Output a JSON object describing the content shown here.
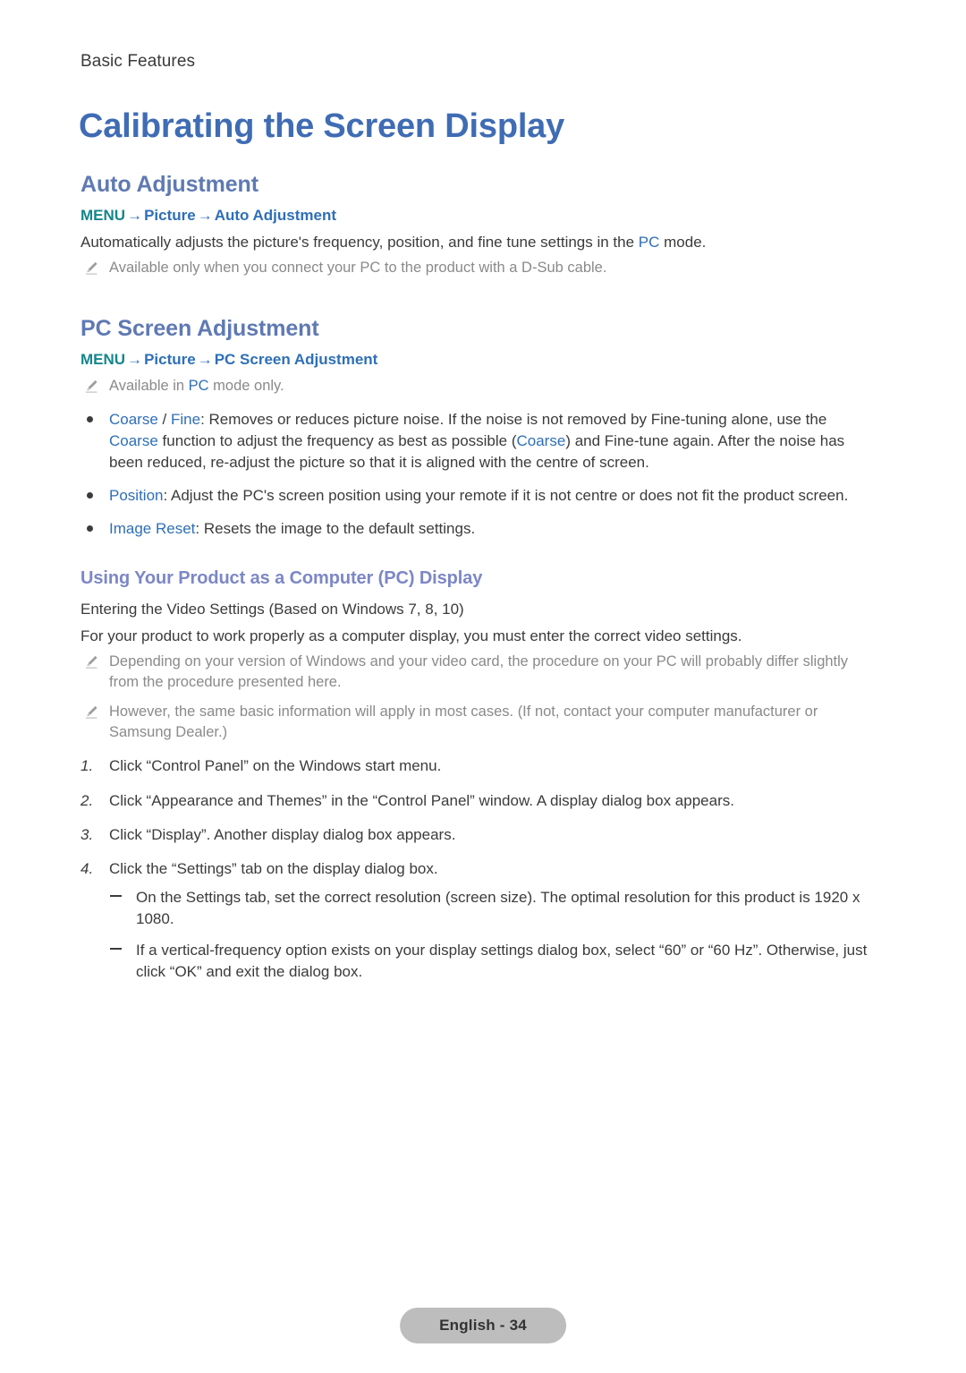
{
  "header": {
    "breadcrumb": "Basic Features"
  },
  "title": "Calibrating the Screen Display",
  "sections": {
    "auto_adjustment": {
      "heading": "Auto Adjustment",
      "menu_path": {
        "menu": "MENU",
        "arrow": "→",
        "item1": "Picture",
        "item2": "Auto Adjustment"
      },
      "description_pre": "Automatically adjusts the picture's frequency, position, and fine tune settings in the ",
      "description_blue": "PC",
      "description_post": " mode.",
      "note": "Available only when you connect your PC to the product with a D-Sub cable."
    },
    "pc_screen_adjustment": {
      "heading": "PC Screen Adjustment",
      "menu_path": {
        "menu": "MENU",
        "arrow": "→",
        "item1": "Picture",
        "item2": "PC Screen Adjustment"
      },
      "note_pre": "Available in ",
      "note_blue": "PC",
      "note_post": " mode only.",
      "bullets": [
        {
          "term1": "Coarse",
          "sep": " / ",
          "term2": "Fine",
          "text_a": ": Removes or reduces picture noise. If the noise is not removed by Fine-tuning alone, use the ",
          "term3": "Coarse",
          "text_b": " function to adjust the frequency as best as possible (",
          "term4": "Coarse",
          "text_c": ") and Fine-tune again. After the noise has been reduced, re-adjust the picture so that it is aligned with the centre of screen."
        },
        {
          "term": "Position",
          "text": ": Adjust the PC's screen position using your remote if it is not centre or does not fit the product screen."
        },
        {
          "term": "Image Reset",
          "text": ": Resets the image to the default settings."
        }
      ]
    },
    "pc_display": {
      "heading": "Using Your Product as a Computer (PC) Display",
      "line1": "Entering the Video Settings (Based on Windows 7, 8, 10)",
      "line2": "For your product to work properly as a computer display, you must enter the correct video settings.",
      "notes": [
        "Depending on your version of Windows and your video card, the procedure on your PC will probably differ slightly from the procedure presented here.",
        "However, the same basic information will apply in most cases. (If not, contact your computer manufacturer or Samsung Dealer.)"
      ],
      "steps": [
        {
          "num": "1.",
          "text": "Click “Control Panel” on the Windows start menu."
        },
        {
          "num": "2.",
          "text": "Click “Appearance and Themes” in the “Control Panel” window. A display dialog box appears."
        },
        {
          "num": "3.",
          "text": "Click “Display”. Another display dialog box appears."
        },
        {
          "num": "4.",
          "text": "Click the “Settings” tab on the display dialog box."
        }
      ],
      "substeps": [
        "On the Settings tab, set the correct resolution (screen size). The optimal resolution for this product is 1920 x 1080.",
        "If a vertical-frequency option exists on your display settings dialog box, select “60” or “60 Hz”. Otherwise, just click “OK” and exit the dialog box."
      ]
    }
  },
  "footer": {
    "page_label": "English - 34"
  },
  "colors": {
    "title_blue": "#3f6cb4",
    "h2_blue": "#5f79b3",
    "h3_periwinkle": "#7c87c6",
    "menu_teal": "#15868c",
    "link_blue": "#2e6fb7",
    "body_gray": "#3b3b3b",
    "note_gray": "#8a8a8a",
    "footer_pill": "#bdbdbd"
  }
}
